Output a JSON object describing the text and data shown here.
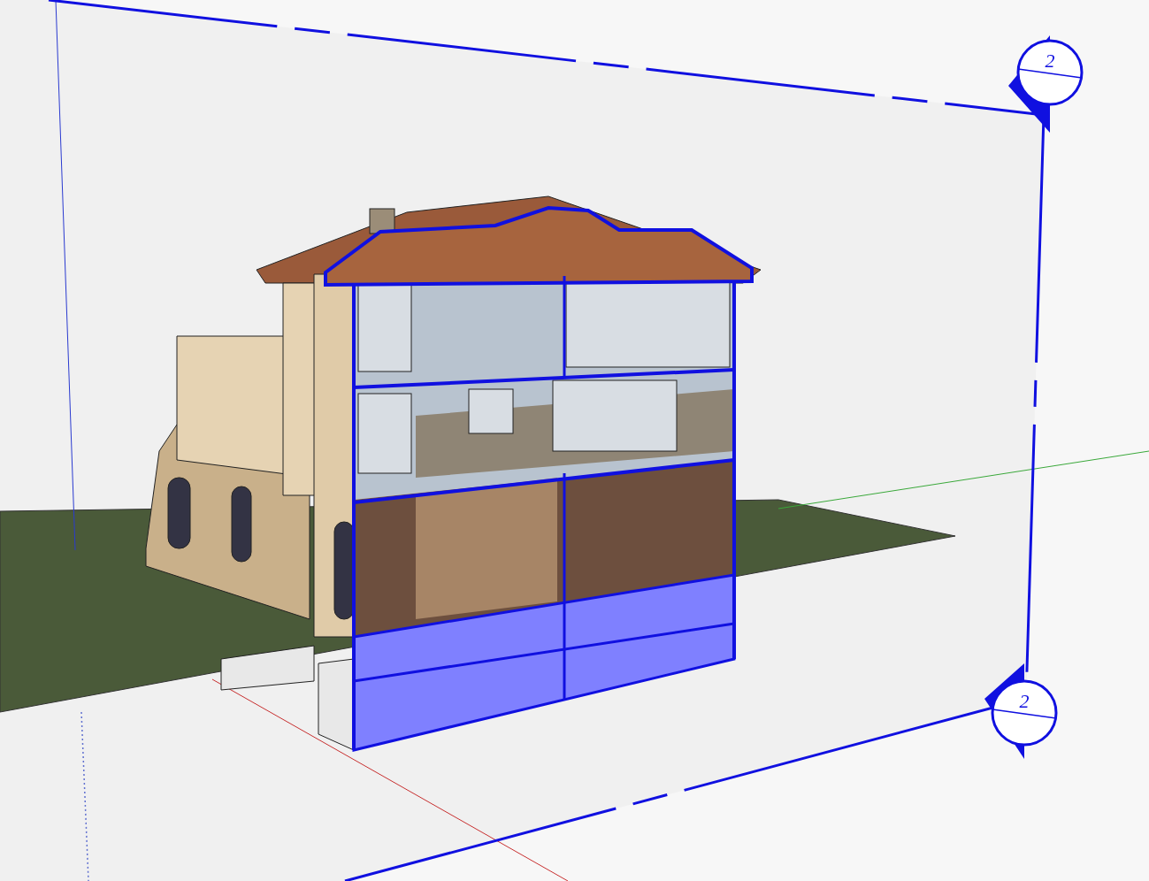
{
  "section_markers": [
    {
      "label": "2"
    },
    {
      "label": "2"
    }
  ]
}
